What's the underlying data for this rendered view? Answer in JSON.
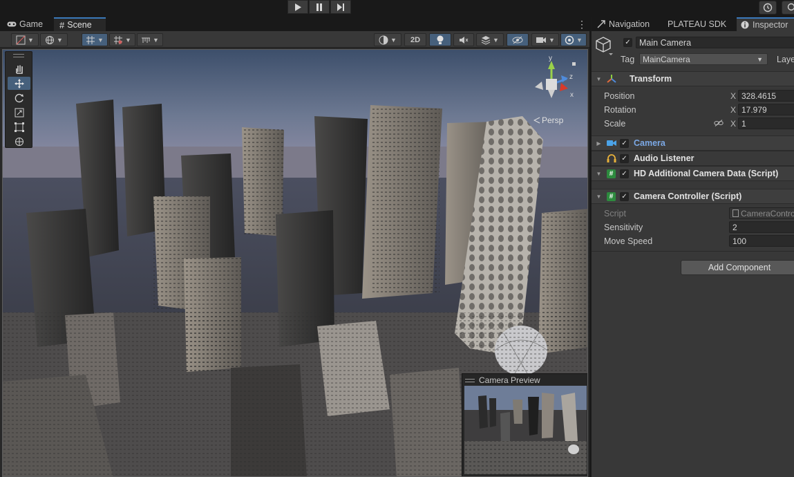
{
  "window_tabs": {
    "game": "Game",
    "scene": "Scene"
  },
  "scene_toolbar": {
    "mode_2d": "2D"
  },
  "viewport": {
    "persp_label": "Persp",
    "gizmo_y": "y",
    "gizmo_z": "z",
    "gizmo_x": "x"
  },
  "camera_preview": {
    "title": "Camera Preview"
  },
  "inspector_tabs": {
    "navigation": "Navigation",
    "plateau": "PLATEAU SDK",
    "inspector": "Inspector"
  },
  "object": {
    "name": "Main Camera",
    "tag_label": "Tag",
    "tag_value": "MainCamera",
    "layer_label": "Laye"
  },
  "transform": {
    "title": "Transform",
    "position_label": "Position",
    "position_x": "328.4615",
    "rotation_label": "Rotation",
    "rotation_x": "17.979",
    "scale_label": "Scale",
    "scale_x": "1",
    "axis_x": "X"
  },
  "components": {
    "camera": "Camera",
    "audio_listener": "Audio Listener",
    "hd_camera_data": "HD Additional Camera Data (Script)",
    "camera_controller": "Camera Controller (Script)"
  },
  "camera_controller": {
    "script_label": "Script",
    "script_value": "CameraContro",
    "sensitivity_label": "Sensitivity",
    "sensitivity_value": "2",
    "move_speed_label": "Move Speed",
    "move_speed_value": "100"
  },
  "add_component": "Add Component",
  "colors": {
    "accent": "#3a79bb",
    "active_tool": "#46607c",
    "camera_link": "#7ca9e6",
    "panel": "#383838"
  }
}
